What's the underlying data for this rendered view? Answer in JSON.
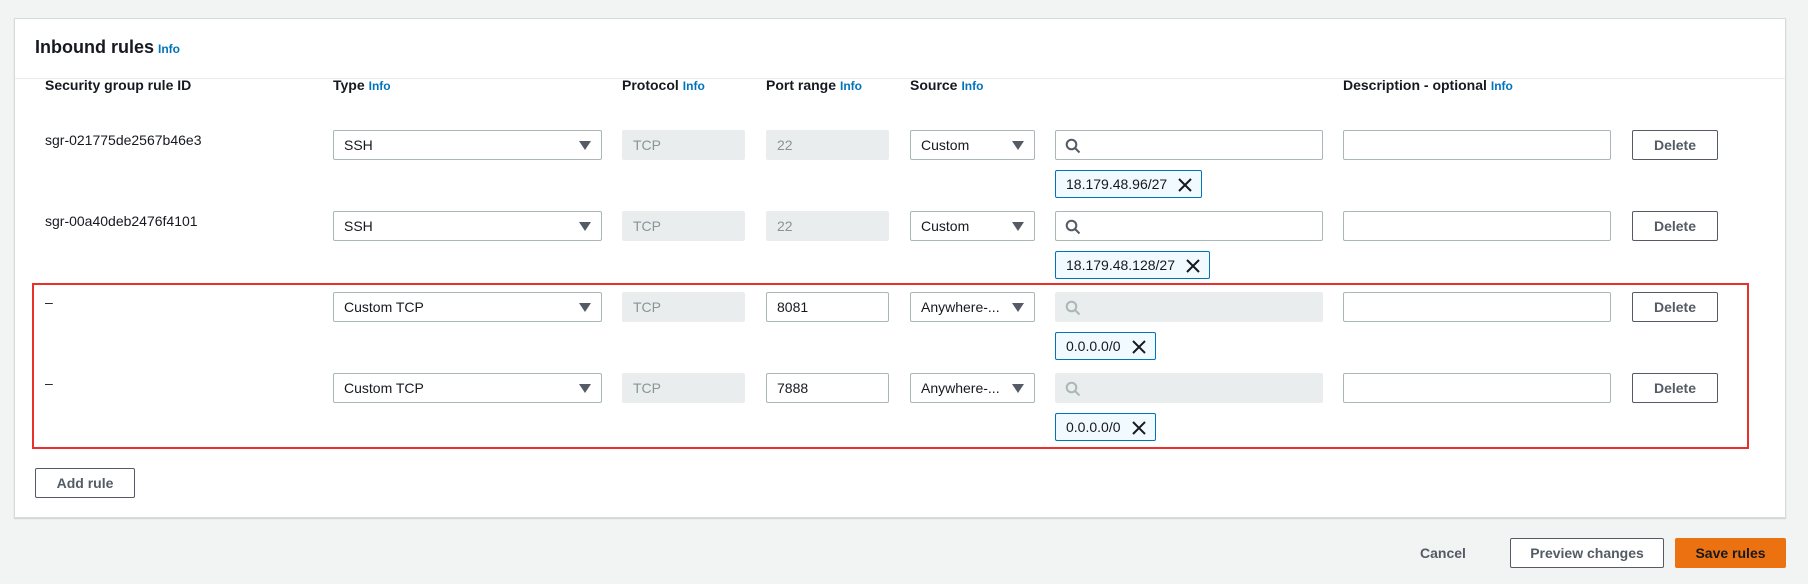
{
  "panel": {
    "title": "Inbound rules",
    "info_label": "Info"
  },
  "columns": {
    "rule_id": "Security group rule ID",
    "type": "Type",
    "protocol": "Protocol",
    "port_range": "Port range",
    "source": "Source",
    "description": "Description - optional",
    "info": "Info"
  },
  "rules": [
    {
      "id": "sgr-021775de2567b46e3",
      "type": "SSH",
      "protocol": "TCP",
      "port": "22",
      "source": "Custom",
      "token": "18.179.48.96/27",
      "description": "",
      "delete": "Delete"
    },
    {
      "id": "sgr-00a40deb2476f4101",
      "type": "SSH",
      "protocol": "TCP",
      "port": "22",
      "source": "Custom",
      "token": "18.179.48.128/27",
      "description": "",
      "delete": "Delete"
    },
    {
      "id": "–",
      "type": "Custom TCP",
      "protocol": "TCP",
      "port": "8081",
      "source": "Anywhere-...",
      "token": "0.0.0.0/0",
      "description": "",
      "delete": "Delete"
    },
    {
      "id": "–",
      "type": "Custom TCP",
      "protocol": "TCP",
      "port": "7888",
      "source": "Anywhere-...",
      "token": "0.0.0.0/0",
      "description": "",
      "delete": "Delete"
    }
  ],
  "add_rule": "Add rule",
  "footer": {
    "cancel": "Cancel",
    "preview": "Preview changes",
    "save": "Save rules"
  },
  "colors": {
    "accent": "#ec7211",
    "link": "#0073bb",
    "highlight": "#e8312a"
  }
}
